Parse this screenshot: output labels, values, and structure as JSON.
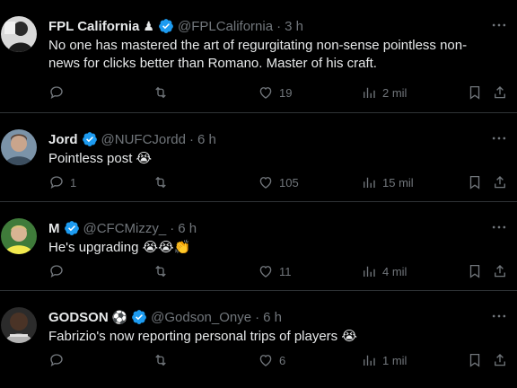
{
  "tweets": [
    {
      "name": "FPL California",
      "name_badge": "♟",
      "handle": "@FPLCalifornia",
      "separator": "·",
      "time": "3 h",
      "text": "No one has mastered the art of regurgitating non-sense pointless non-news for clicks better than Romano. Master of his craft.",
      "replies": "",
      "retweets": "",
      "likes": "19",
      "views": "2 mil"
    },
    {
      "name": "Jord",
      "name_badge": "",
      "handle": "@NUFCJordd",
      "separator": "·",
      "time": "6 h",
      "text": "Pointless post 😭",
      "replies": "1",
      "retweets": "",
      "likes": "105",
      "views": "15 mil"
    },
    {
      "name": "M",
      "name_badge": "",
      "handle": "@CFCMizzy_",
      "separator": "·",
      "time": "6 h",
      "text": "He's upgrading 😭😭👏",
      "replies": "",
      "retweets": "",
      "likes": "11",
      "views": "4 mil"
    },
    {
      "name": "GODSON",
      "name_badge": "⚽",
      "handle": "@Godson_Onye",
      "separator": "·",
      "time": "6 h",
      "text": "Fabrizio's now reporting personal trips of players 😭",
      "replies": "",
      "retweets": "",
      "likes": "6",
      "views": "1 mil"
    }
  ],
  "icons": {
    "verified": "verified-badge-icon",
    "more": "more-dots-icon",
    "reply": "reply-icon",
    "retweet": "retweet-icon",
    "like": "heart-icon",
    "views": "views-chart-icon",
    "bookmark": "bookmark-icon",
    "share": "share-icon"
  },
  "colors": {
    "background": "#000000",
    "text": "#e7e9ea",
    "muted": "#71767b",
    "verified": "#1d9bf0",
    "divider": "#2f3336"
  }
}
